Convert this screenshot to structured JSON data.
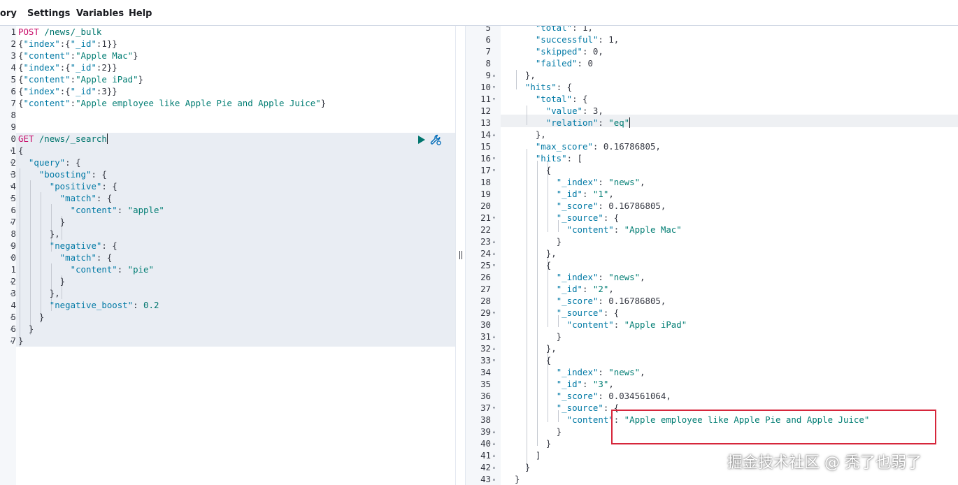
{
  "menu": {
    "items": [
      {
        "label": "ory"
      },
      {
        "label": "Settings"
      },
      {
        "label": "Variables"
      },
      {
        "label": "Help"
      }
    ]
  },
  "request_editor": {
    "lines": [
      {
        "n": "1",
        "fold": "",
        "tokens": [
          [
            "m",
            "POST "
          ],
          [
            "u",
            "/news/_bulk"
          ]
        ]
      },
      {
        "n": "2",
        "fold": "",
        "tokens": [
          [
            "p",
            "{"
          ],
          [
            "k",
            "\"index\""
          ],
          [
            "p",
            ":{"
          ],
          [
            "k",
            "\"_id\""
          ],
          [
            "p",
            ":1}}"
          ]
        ]
      },
      {
        "n": "3",
        "fold": "",
        "tokens": [
          [
            "p",
            "{"
          ],
          [
            "k",
            "\"content\""
          ],
          [
            "p",
            ":"
          ],
          [
            "s",
            "\"Apple Mac\""
          ],
          [
            "p",
            "}"
          ]
        ]
      },
      {
        "n": "4",
        "fold": "",
        "tokens": [
          [
            "p",
            "{"
          ],
          [
            "k",
            "\"index\""
          ],
          [
            "p",
            ":{"
          ],
          [
            "k",
            "\"_id\""
          ],
          [
            "p",
            ":2}}"
          ]
        ]
      },
      {
        "n": "5",
        "fold": "",
        "tokens": [
          [
            "p",
            "{"
          ],
          [
            "k",
            "\"content\""
          ],
          [
            "p",
            ":"
          ],
          [
            "s",
            "\"Apple iPad\""
          ],
          [
            "p",
            "}"
          ]
        ]
      },
      {
        "n": "6",
        "fold": "",
        "tokens": [
          [
            "p",
            "{"
          ],
          [
            "k",
            "\"index\""
          ],
          [
            "p",
            ":{"
          ],
          [
            "k",
            "\"_id\""
          ],
          [
            "p",
            ":3}}"
          ]
        ]
      },
      {
        "n": "7",
        "fold": "",
        "tokens": [
          [
            "p",
            "{"
          ],
          [
            "k",
            "\"content\""
          ],
          [
            "p",
            ":"
          ],
          [
            "s",
            "\"Apple employee like Apple Pie and Apple Juice\""
          ],
          [
            "p",
            "}"
          ]
        ]
      },
      {
        "n": "8",
        "fold": "",
        "tokens": []
      },
      {
        "n": "9",
        "fold": "",
        "tokens": []
      },
      {
        "n": "0",
        "fold": "",
        "tokens": [
          [
            "m",
            "GET "
          ],
          [
            "u",
            "/news/_search"
          ]
        ]
      },
      {
        "n": "1",
        "fold": "▾",
        "tokens": [
          [
            "p",
            "{"
          ]
        ]
      },
      {
        "n": "2",
        "fold": "▾",
        "tokens": [
          [
            "p",
            "  "
          ],
          [
            "k",
            "\"query\""
          ],
          [
            "p",
            ": {"
          ]
        ]
      },
      {
        "n": "3",
        "fold": "▾",
        "tokens": [
          [
            "p",
            "    "
          ],
          [
            "k",
            "\"boosting\""
          ],
          [
            "p",
            ": {"
          ]
        ]
      },
      {
        "n": "4",
        "fold": "▾",
        "tokens": [
          [
            "p",
            "      "
          ],
          [
            "k",
            "\"positive\""
          ],
          [
            "p",
            ": {"
          ]
        ]
      },
      {
        "n": "5",
        "fold": "▾",
        "tokens": [
          [
            "p",
            "        "
          ],
          [
            "k",
            "\"match\""
          ],
          [
            "p",
            ": {"
          ]
        ]
      },
      {
        "n": "6",
        "fold": "",
        "tokens": [
          [
            "p",
            "          "
          ],
          [
            "k",
            "\"content\""
          ],
          [
            "p",
            ": "
          ],
          [
            "s",
            "\"apple\""
          ]
        ]
      },
      {
        "n": "7",
        "fold": "▴",
        "tokens": [
          [
            "p",
            "        }"
          ]
        ]
      },
      {
        "n": "8",
        "fold": "",
        "tokens": [
          [
            "p",
            "      },"
          ]
        ]
      },
      {
        "n": "9",
        "fold": "▾",
        "tokens": [
          [
            "p",
            "      "
          ],
          [
            "k",
            "\"negative\""
          ],
          [
            "p",
            ": {"
          ]
        ]
      },
      {
        "n": "0",
        "fold": "▾",
        "tokens": [
          [
            "p",
            "        "
          ],
          [
            "k",
            "\"match\""
          ],
          [
            "p",
            ": {"
          ]
        ]
      },
      {
        "n": "1",
        "fold": "",
        "tokens": [
          [
            "p",
            "          "
          ],
          [
            "k",
            "\"content\""
          ],
          [
            "p",
            ": "
          ],
          [
            "s",
            "\"pie\""
          ]
        ]
      },
      {
        "n": "2",
        "fold": "▴",
        "tokens": [
          [
            "p",
            "        }"
          ]
        ]
      },
      {
        "n": "3",
        "fold": "▴",
        "tokens": [
          [
            "p",
            "      },"
          ]
        ]
      },
      {
        "n": "4",
        "fold": "",
        "tokens": [
          [
            "p",
            "      "
          ],
          [
            "k",
            "\"negative_boost\""
          ],
          [
            "p",
            ": "
          ],
          [
            "n",
            "0.2"
          ]
        ]
      },
      {
        "n": "5",
        "fold": "▴",
        "tokens": [
          [
            "p",
            "    }"
          ]
        ]
      },
      {
        "n": "6",
        "fold": "▴",
        "tokens": [
          [
            "p",
            "  }"
          ]
        ]
      },
      {
        "n": "7",
        "fold": "▴",
        "tokens": [
          [
            "p",
            "}"
          ]
        ]
      }
    ]
  },
  "response_viewer": {
    "lines": [
      {
        "n": "5",
        "fold": "",
        "tokens": [
          [
            "p",
            "    "
          ],
          [
            "k",
            "\"total\""
          ],
          [
            "p",
            ": 1,"
          ]
        ]
      },
      {
        "n": "6",
        "fold": "",
        "tokens": [
          [
            "p",
            "    "
          ],
          [
            "k",
            "\"successful\""
          ],
          [
            "p",
            ": 1,"
          ]
        ]
      },
      {
        "n": "7",
        "fold": "",
        "tokens": [
          [
            "p",
            "    "
          ],
          [
            "k",
            "\"skipped\""
          ],
          [
            "p",
            ": 0,"
          ]
        ]
      },
      {
        "n": "8",
        "fold": "",
        "tokens": [
          [
            "p",
            "    "
          ],
          [
            "k",
            "\"failed\""
          ],
          [
            "p",
            ": 0"
          ]
        ]
      },
      {
        "n": "9",
        "fold": "▴",
        "tokens": [
          [
            "p",
            "  },"
          ]
        ]
      },
      {
        "n": "10",
        "fold": "▾",
        "tokens": [
          [
            "p",
            "  "
          ],
          [
            "k",
            "\"hits\""
          ],
          [
            "p",
            ": {"
          ]
        ]
      },
      {
        "n": "11",
        "fold": "▾",
        "tokens": [
          [
            "p",
            "    "
          ],
          [
            "k",
            "\"total\""
          ],
          [
            "p",
            ": {"
          ]
        ]
      },
      {
        "n": "12",
        "fold": "",
        "tokens": [
          [
            "p",
            "      "
          ],
          [
            "k",
            "\"value\""
          ],
          [
            "p",
            ": 3,"
          ]
        ]
      },
      {
        "n": "13",
        "fold": "",
        "tokens": [
          [
            "p",
            "      "
          ],
          [
            "k",
            "\"relation\""
          ],
          [
            "p",
            ": "
          ],
          [
            "s",
            "\"eq\""
          ]
        ]
      },
      {
        "n": "14",
        "fold": "▴",
        "tokens": [
          [
            "p",
            "    },"
          ]
        ]
      },
      {
        "n": "15",
        "fold": "",
        "tokens": [
          [
            "p",
            "    "
          ],
          [
            "k",
            "\"max_score\""
          ],
          [
            "p",
            ": 0.16786805,"
          ]
        ]
      },
      {
        "n": "16",
        "fold": "▾",
        "tokens": [
          [
            "p",
            "    "
          ],
          [
            "k",
            "\"hits\""
          ],
          [
            "p",
            ": ["
          ]
        ]
      },
      {
        "n": "17",
        "fold": "▾",
        "tokens": [
          [
            "p",
            "      {"
          ]
        ]
      },
      {
        "n": "18",
        "fold": "",
        "tokens": [
          [
            "p",
            "        "
          ],
          [
            "k",
            "\"_index\""
          ],
          [
            "p",
            ": "
          ],
          [
            "s",
            "\"news\""
          ],
          [
            "p",
            ","
          ]
        ]
      },
      {
        "n": "19",
        "fold": "",
        "tokens": [
          [
            "p",
            "        "
          ],
          [
            "k",
            "\"_id\""
          ],
          [
            "p",
            ": "
          ],
          [
            "s",
            "\"1\""
          ],
          [
            "p",
            ","
          ]
        ]
      },
      {
        "n": "20",
        "fold": "",
        "tokens": [
          [
            "p",
            "        "
          ],
          [
            "k",
            "\"_score\""
          ],
          [
            "p",
            ": 0.16786805,"
          ]
        ]
      },
      {
        "n": "21",
        "fold": "▾",
        "tokens": [
          [
            "p",
            "        "
          ],
          [
            "k",
            "\"_source\""
          ],
          [
            "p",
            ": {"
          ]
        ]
      },
      {
        "n": "22",
        "fold": "",
        "tokens": [
          [
            "p",
            "          "
          ],
          [
            "k",
            "\"content\""
          ],
          [
            "p",
            ": "
          ],
          [
            "s",
            "\"Apple Mac\""
          ]
        ]
      },
      {
        "n": "23",
        "fold": "▴",
        "tokens": [
          [
            "p",
            "        }"
          ]
        ]
      },
      {
        "n": "24",
        "fold": "▴",
        "tokens": [
          [
            "p",
            "      },"
          ]
        ]
      },
      {
        "n": "25",
        "fold": "▾",
        "tokens": [
          [
            "p",
            "      {"
          ]
        ]
      },
      {
        "n": "26",
        "fold": "",
        "tokens": [
          [
            "p",
            "        "
          ],
          [
            "k",
            "\"_index\""
          ],
          [
            "p",
            ": "
          ],
          [
            "s",
            "\"news\""
          ],
          [
            "p",
            ","
          ]
        ]
      },
      {
        "n": "27",
        "fold": "",
        "tokens": [
          [
            "p",
            "        "
          ],
          [
            "k",
            "\"_id\""
          ],
          [
            "p",
            ": "
          ],
          [
            "s",
            "\"2\""
          ],
          [
            "p",
            ","
          ]
        ]
      },
      {
        "n": "28",
        "fold": "",
        "tokens": [
          [
            "p",
            "        "
          ],
          [
            "k",
            "\"_score\""
          ],
          [
            "p",
            ": 0.16786805,"
          ]
        ]
      },
      {
        "n": "29",
        "fold": "▾",
        "tokens": [
          [
            "p",
            "        "
          ],
          [
            "k",
            "\"_source\""
          ],
          [
            "p",
            ": {"
          ]
        ]
      },
      {
        "n": "30",
        "fold": "",
        "tokens": [
          [
            "p",
            "          "
          ],
          [
            "k",
            "\"content\""
          ],
          [
            "p",
            ": "
          ],
          [
            "s",
            "\"Apple iPad\""
          ]
        ]
      },
      {
        "n": "31",
        "fold": "▴",
        "tokens": [
          [
            "p",
            "        }"
          ]
        ]
      },
      {
        "n": "32",
        "fold": "▴",
        "tokens": [
          [
            "p",
            "      },"
          ]
        ]
      },
      {
        "n": "33",
        "fold": "▾",
        "tokens": [
          [
            "p",
            "      {"
          ]
        ]
      },
      {
        "n": "34",
        "fold": "",
        "tokens": [
          [
            "p",
            "        "
          ],
          [
            "k",
            "\"_index\""
          ],
          [
            "p",
            ": "
          ],
          [
            "s",
            "\"news\""
          ],
          [
            "p",
            ","
          ]
        ]
      },
      {
        "n": "35",
        "fold": "",
        "tokens": [
          [
            "p",
            "        "
          ],
          [
            "k",
            "\"_id\""
          ],
          [
            "p",
            ": "
          ],
          [
            "s",
            "\"3\""
          ],
          [
            "p",
            ","
          ]
        ]
      },
      {
        "n": "36",
        "fold": "",
        "tokens": [
          [
            "p",
            "        "
          ],
          [
            "k",
            "\"_score\""
          ],
          [
            "p",
            ": 0.034561064,"
          ]
        ]
      },
      {
        "n": "37",
        "fold": "▾",
        "tokens": [
          [
            "p",
            "        "
          ],
          [
            "k",
            "\"_source\""
          ],
          [
            "p",
            ": {"
          ]
        ]
      },
      {
        "n": "38",
        "fold": "",
        "tokens": [
          [
            "p",
            "          "
          ],
          [
            "k",
            "\"content\""
          ],
          [
            "p",
            ": "
          ],
          [
            "s",
            "\"Apple employee like Apple Pie and Apple Juice\""
          ]
        ]
      },
      {
        "n": "39",
        "fold": "▴",
        "tokens": [
          [
            "p",
            "        }"
          ]
        ]
      },
      {
        "n": "40",
        "fold": "▴",
        "tokens": [
          [
            "p",
            "      }"
          ]
        ]
      },
      {
        "n": "41",
        "fold": "▴",
        "tokens": [
          [
            "p",
            "    ]"
          ]
        ]
      },
      {
        "n": "42",
        "fold": "▴",
        "tokens": [
          [
            "p",
            "  }"
          ]
        ]
      },
      {
        "n": "43",
        "fold": "▴",
        "tokens": [
          [
            "p",
            "}"
          ]
        ]
      }
    ]
  },
  "icons": {
    "run": "play-icon",
    "settings": "wrench-icon",
    "resize": "splitter-grip-icon"
  },
  "colors": {
    "method": "#c80a68",
    "key": "#0079a5",
    "string": "#017d73",
    "highlight_box": "#d6263b"
  },
  "watermark": {
    "text": "掘金技术社区 @ 秃了也弱了"
  }
}
